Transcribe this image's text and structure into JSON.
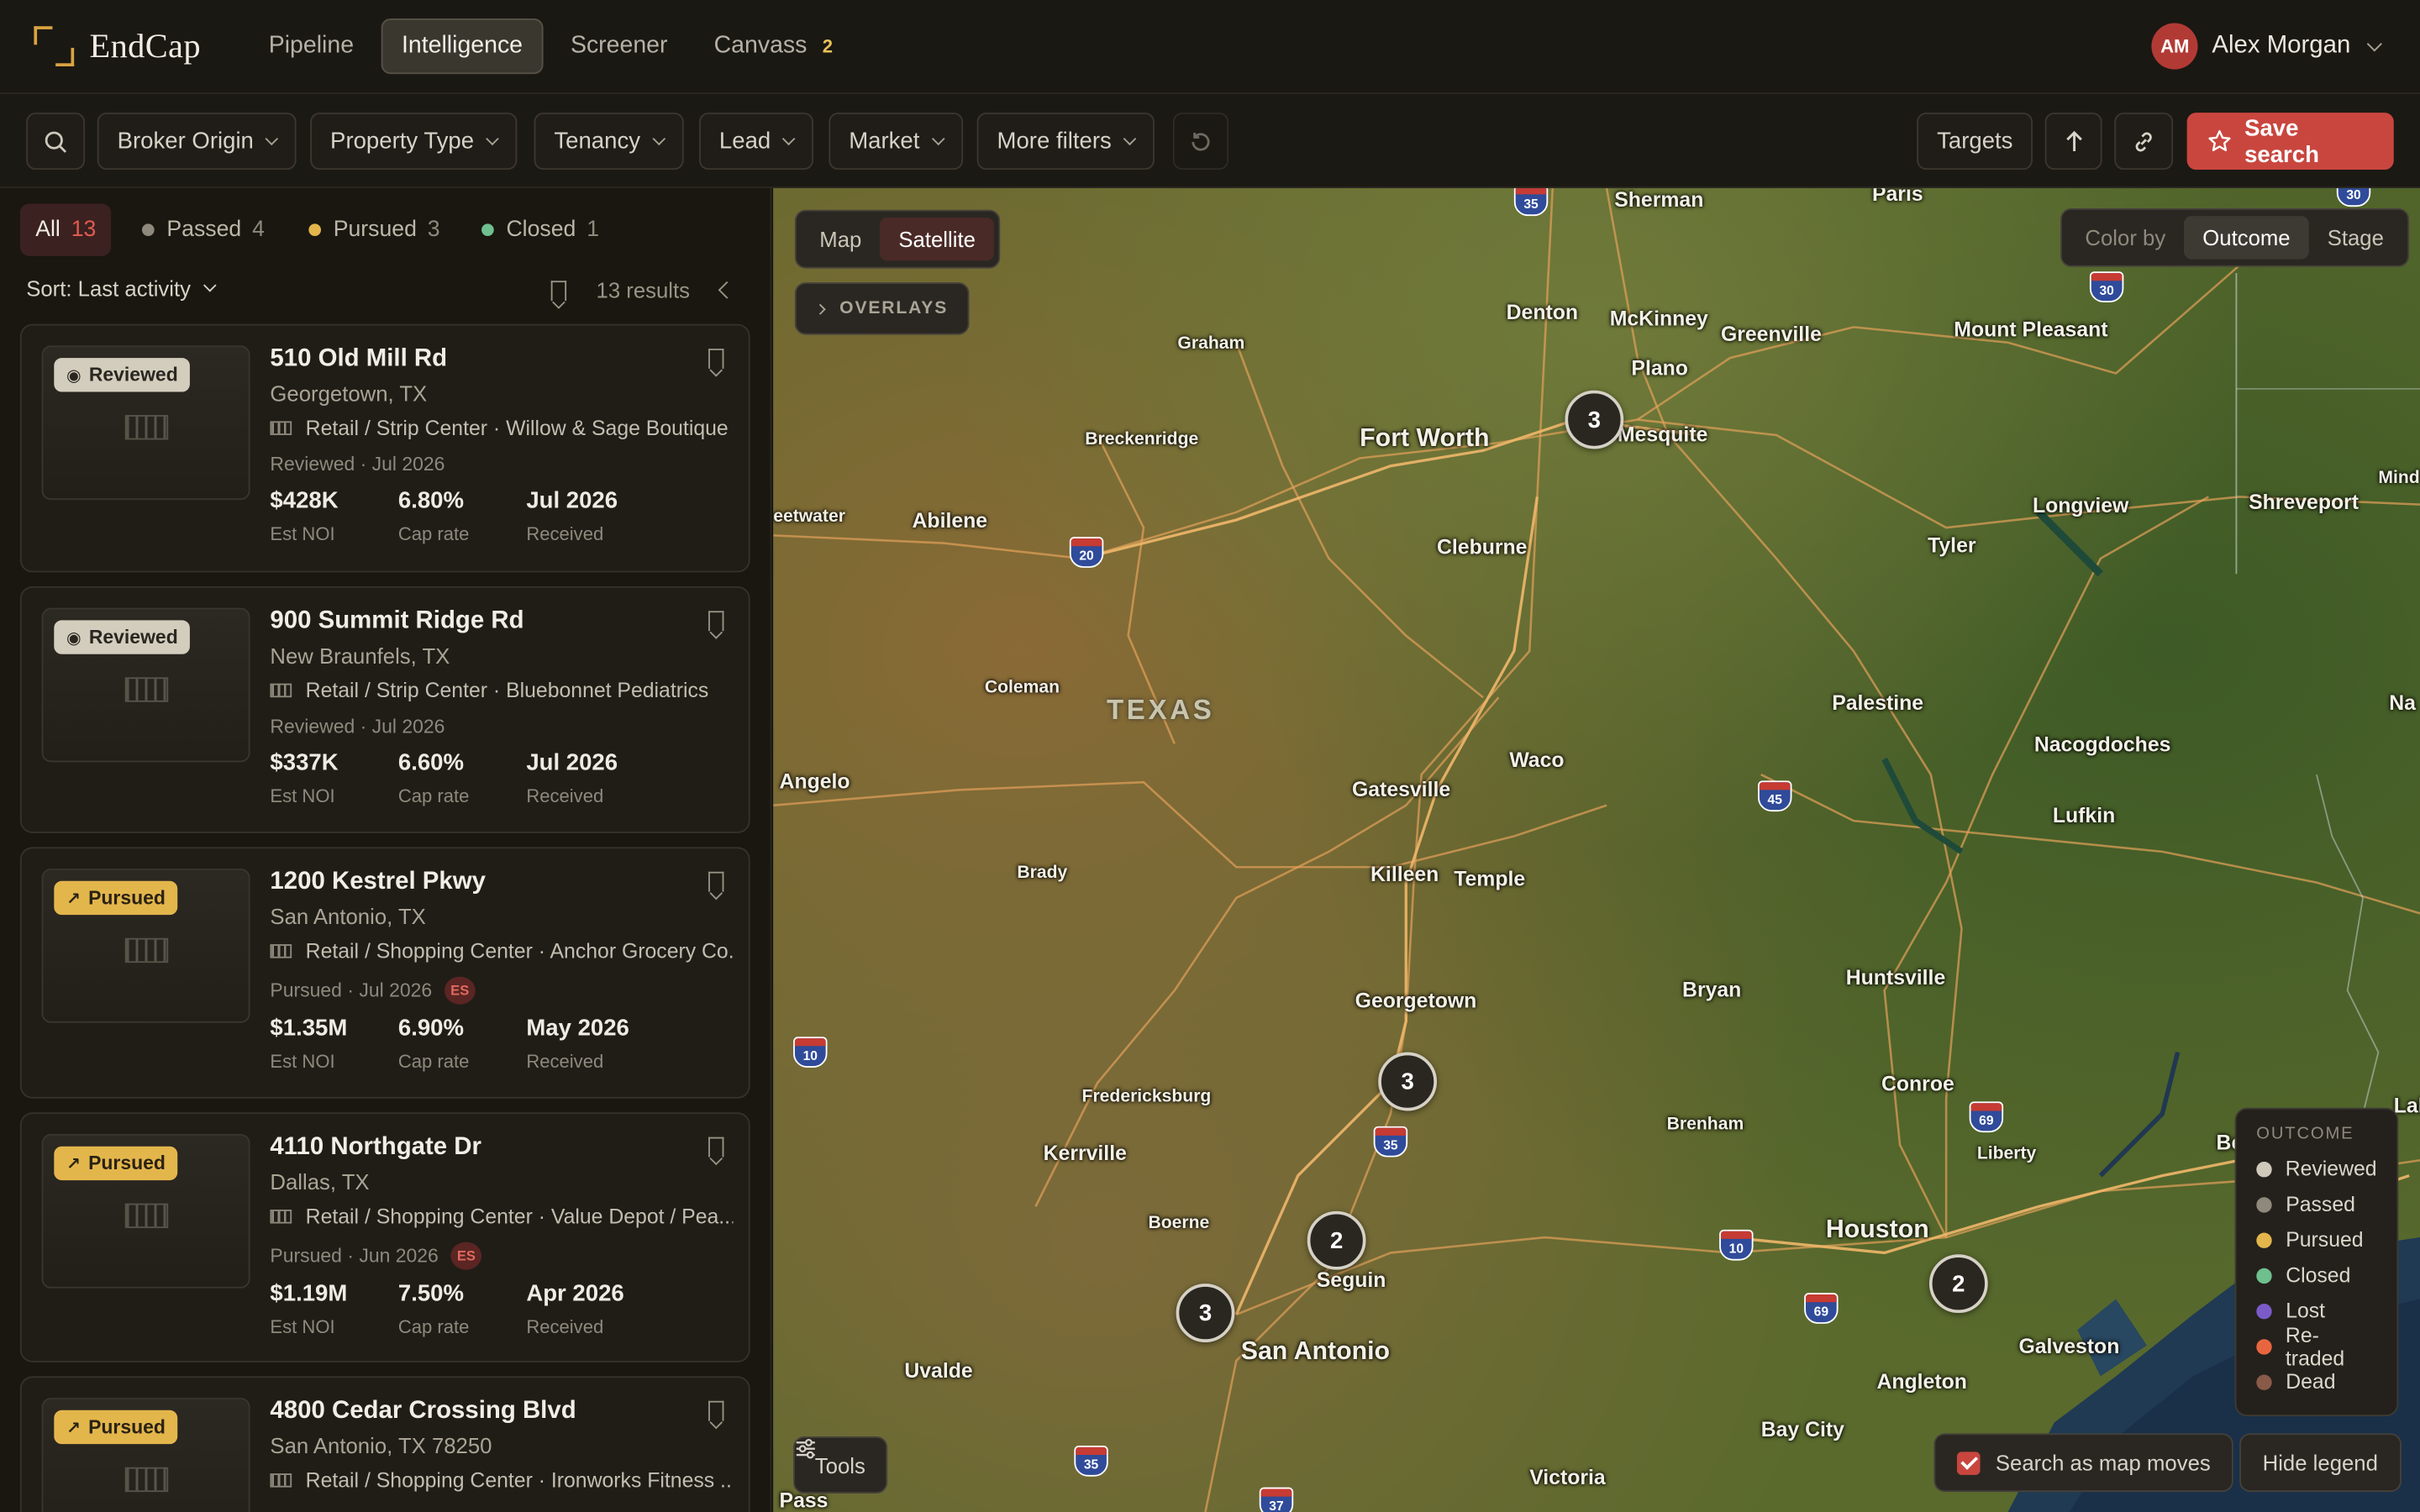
{
  "app": {
    "brand": "EndCap"
  },
  "nav": {
    "tabs": [
      {
        "label": "Pipeline"
      },
      {
        "label": "Intelligence",
        "active": true
      },
      {
        "label": "Screener"
      },
      {
        "label": "Canvass",
        "count": "2"
      }
    ],
    "user": {
      "initials": "AM",
      "name": "Alex Morgan"
    }
  },
  "filters": {
    "items": [
      "Broker Origin",
      "Property Type",
      "Tenancy",
      "Lead",
      "Market",
      "More filters"
    ],
    "targets": "Targets",
    "save": "Save search"
  },
  "list": {
    "pills": [
      {
        "label": "All",
        "count": "13",
        "active": true
      },
      {
        "label": "Passed",
        "count": "4",
        "color": "#8f897d"
      },
      {
        "label": "Pursued",
        "count": "3",
        "color": "#e3b64c"
      },
      {
        "label": "Closed",
        "count": "1",
        "color": "#6fbf8f"
      }
    ],
    "sort": "Sort: Last activity",
    "results": "13 results",
    "cards": [
      {
        "badge": "Reviewed",
        "badge_type": "reviewed",
        "title": "510 Old Mill Rd",
        "city": "Georgetown, TX",
        "type": "Retail / Strip Center · Willow & Sage Boutique",
        "status": "Reviewed · Jul 2026",
        "noi": "$428K",
        "cap": "6.80%",
        "received": "Jul 2026"
      },
      {
        "badge": "Reviewed",
        "badge_type": "reviewed",
        "title": "900 Summit Ridge Rd",
        "city": "New Braunfels, TX",
        "type": "Retail / Strip Center · Bluebonnet Pediatrics",
        "status": "Reviewed · Jul 2026",
        "noi": "$337K",
        "cap": "6.60%",
        "received": "Jul 2026"
      },
      {
        "badge": "Pursued",
        "badge_type": "pursued",
        "title": "1200 Kestrel Pkwy",
        "city": "San Antonio, TX",
        "type": "Retail / Shopping Center · Anchor Grocery Co.",
        "status": "Pursued · Jul 2026",
        "es": "ES",
        "noi": "$1.35M",
        "cap": "6.90%",
        "received": "May 2026"
      },
      {
        "badge": "Pursued",
        "badge_type": "pursued",
        "title": "4110 Northgate Dr",
        "city": "Dallas, TX",
        "type": "Retail / Shopping Center · Value Depot / Pea...",
        "status": "Pursued · Jun 2026",
        "es": "ES",
        "noi": "$1.19M",
        "cap": "7.50%",
        "received": "Apr 2026"
      },
      {
        "badge": "Pursued",
        "badge_type": "pursued",
        "title": "4800 Cedar Crossing Blvd",
        "city": "San Antonio, TX 78250",
        "type": "Retail / Shopping Center · Ironworks Fitness ...",
        "status": "",
        "noi": "",
        "cap": "",
        "received": ""
      }
    ],
    "metric_labels": {
      "noi": "Est NOI",
      "cap": "Cap rate",
      "received": "Received"
    }
  },
  "map": {
    "modes": [
      "Map",
      "Satellite"
    ],
    "overlays": "OVERLAYS",
    "color_by": {
      "label": "Color by",
      "options": [
        "Outcome",
        "Stage"
      ]
    },
    "clusters": [
      "3",
      "3",
      "2",
      "3",
      "2"
    ],
    "region": "TEXAS",
    "cities": [
      "Sherman",
      "Paris",
      "Denton",
      "McKinney",
      "Greenville",
      "Mount Pleasant",
      "Graham",
      "Plano",
      "Fort Worth",
      "Mesquite",
      "Breckenridge",
      "Abilene",
      "eetwater",
      "Cleburne",
      "Longview",
      "Shreveport",
      "Tyler",
      "Coleman",
      "Palestine",
      "Nacogdoches",
      "Waco",
      "Angelo",
      "Gatesville",
      "Lufkin",
      "Brady",
      "Killeen",
      "Temple",
      "Georgetown",
      "Bryan",
      "Huntsville",
      "Fredericksburg",
      "Conroe",
      "Kerrville",
      "Brenham",
      "Liberty",
      "Boerne",
      "Houston",
      "Seguin",
      "Beaum",
      "San Antonio",
      "Galveston",
      "Uvalde",
      "Angleton",
      "Bay City",
      "Victoria",
      "Pass",
      "Mind",
      "Na",
      "Lake C"
    ],
    "shields": [
      "35",
      "30",
      "20",
      "45",
      "10",
      "35",
      "69",
      "10",
      "69",
      "35",
      "37",
      "30"
    ],
    "legend": {
      "title": "OUTCOME",
      "items": [
        {
          "label": "Reviewed",
          "color": "#cfc9bb"
        },
        {
          "label": "Passed",
          "color": "#8f897d"
        },
        {
          "label": "Pursued",
          "color": "#e3b64c"
        },
        {
          "label": "Closed",
          "color": "#6fbf8f"
        },
        {
          "label": "Lost",
          "color": "#7b5bc9"
        },
        {
          "label": "Re-traded",
          "color": "#e8663f"
        },
        {
          "label": "Dead",
          "color": "#8a5a48"
        }
      ]
    },
    "tools": "Tools",
    "search_moves": "Search as map moves",
    "hide_legend": "Hide legend"
  }
}
